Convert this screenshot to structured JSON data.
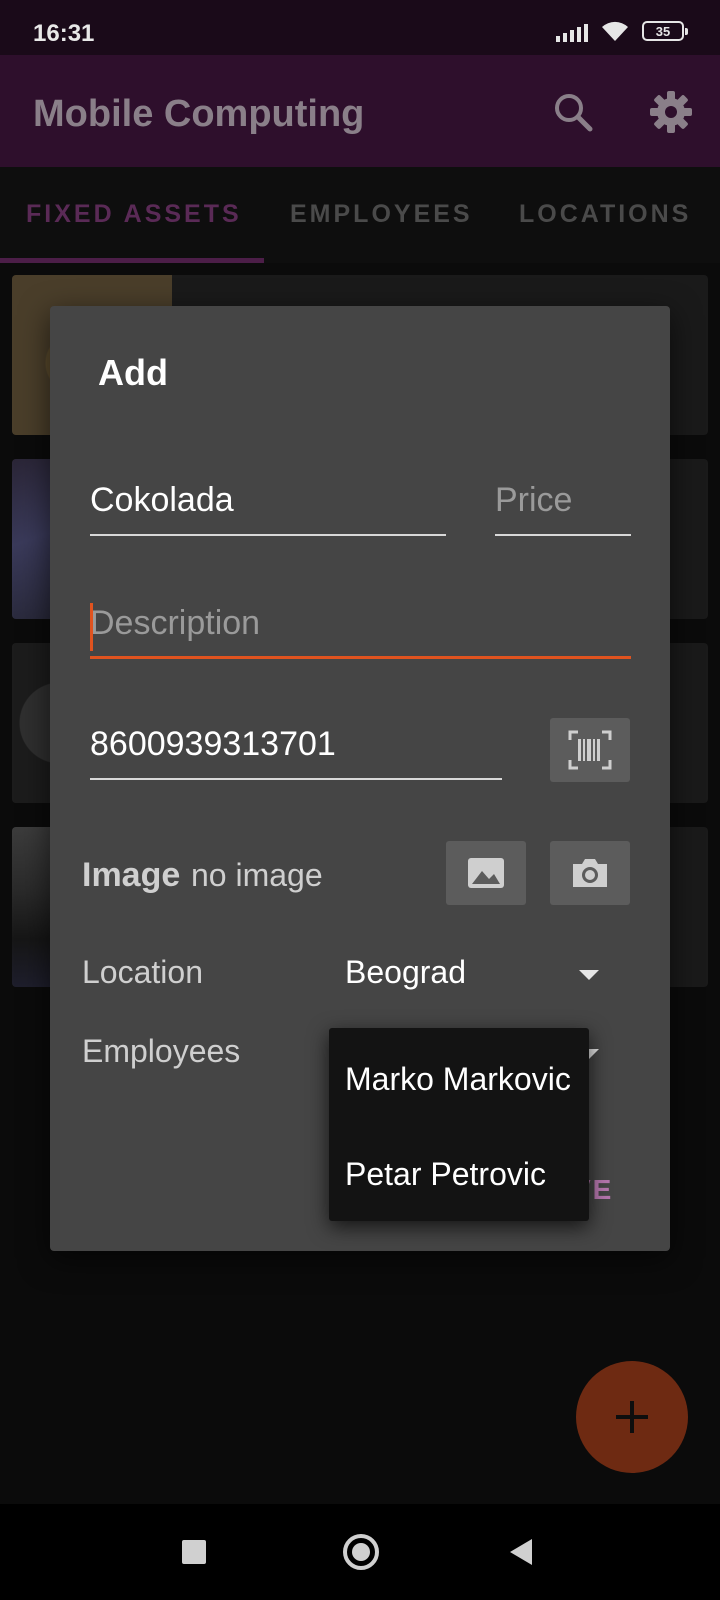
{
  "status_bar": {
    "time": "16:31",
    "battery": "35"
  },
  "app_bar": {
    "title": "Mobile Computing",
    "icons": [
      "search-icon",
      "gear-icon"
    ]
  },
  "tabs": [
    {
      "label": "FIXED ASSETS",
      "active": true
    },
    {
      "label": "EMPLOYEES",
      "active": false
    },
    {
      "label": "LOCATIONS",
      "active": false
    }
  ],
  "dialog": {
    "title": "Add",
    "name_value": "Cokolada",
    "price_placeholder": "Price",
    "description_placeholder": "Description",
    "barcode_value": "8600939313701",
    "image_label": "Image",
    "image_value": "no image",
    "location_label": "Location",
    "location_value": "Beograd",
    "employees_label": "Employees",
    "save_label": "VE"
  },
  "employee_menu": {
    "items": [
      "Marko Markovic",
      "Petar Petrovic"
    ]
  },
  "colors": {
    "accent": "#e0531f",
    "primary_dark": "#2e0f2c",
    "dialog_bg": "#454545",
    "save_text": "#b576ad"
  }
}
